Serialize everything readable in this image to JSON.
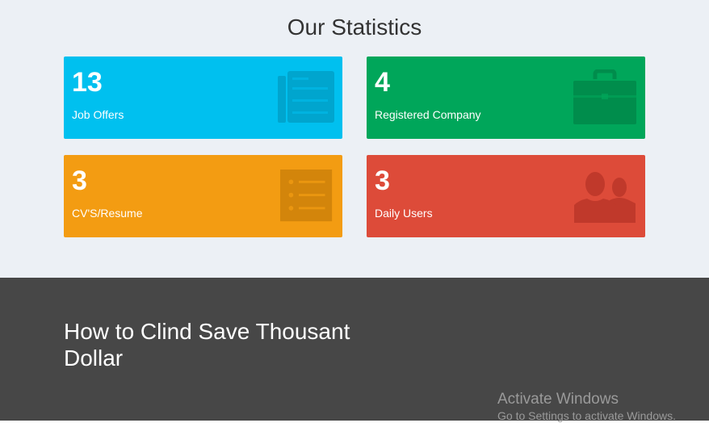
{
  "statistics": {
    "title": "Our Statistics",
    "boxes": [
      {
        "value": "13",
        "label": "Job Offers",
        "icon": "newspaper-icon",
        "color": "#00c0ef",
        "icon_color": "#00a5ce"
      },
      {
        "value": "4",
        "label": "Registered Company",
        "icon": "briefcase-icon",
        "color": "#00a65a",
        "icon_color": "#008d4c"
      },
      {
        "value": "3",
        "label": "CV'S/Resume",
        "icon": "list-icon",
        "color": "#f39c12",
        "icon_color": "#d3850b"
      },
      {
        "value": "3",
        "label": "Daily Users",
        "icon": "users-icon",
        "color": "#dd4b39",
        "icon_color": "#c0392b"
      }
    ]
  },
  "footer": {
    "heading": "How to Clind Save Thousant Dollar",
    "background": "#474747"
  },
  "watermark": {
    "line1": "Activate Windows",
    "line2": "Go to Settings to activate Windows."
  }
}
